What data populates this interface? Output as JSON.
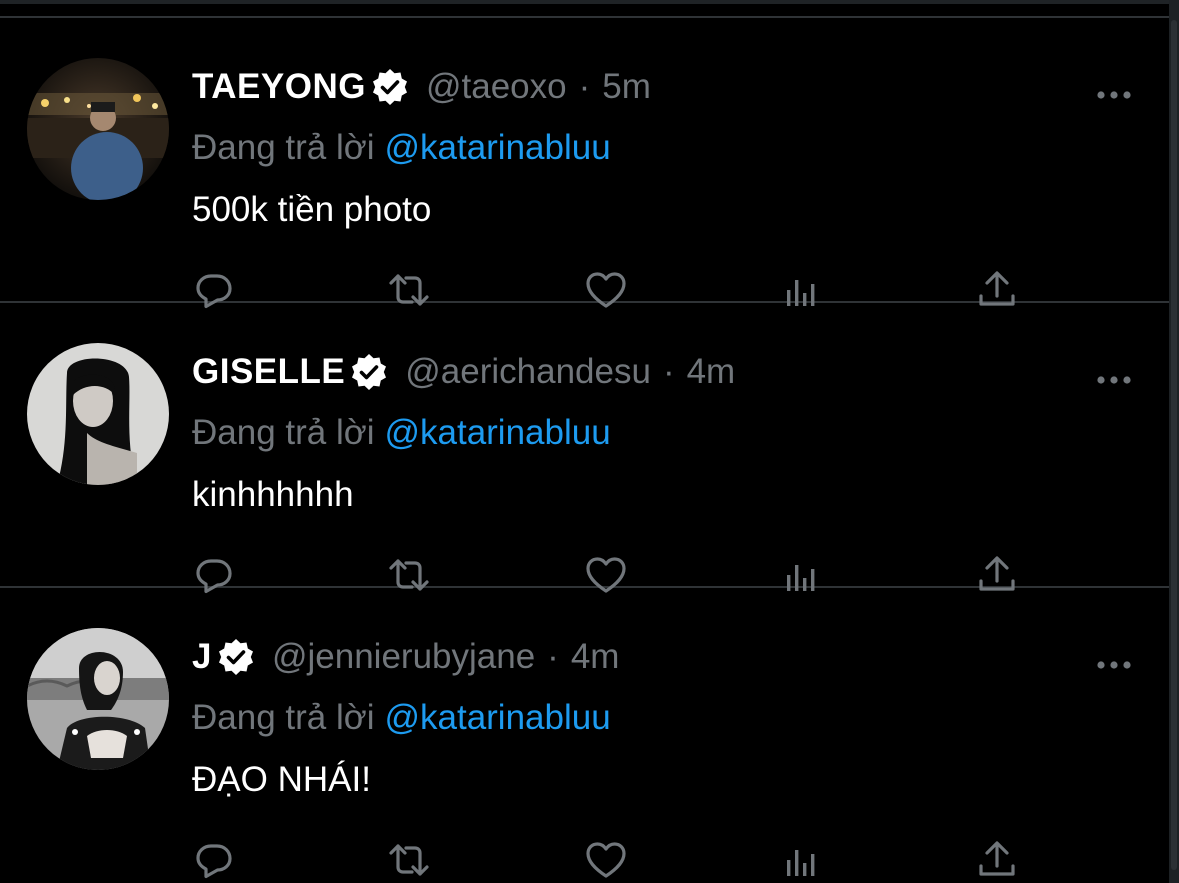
{
  "colors": {
    "background": "#000000",
    "divider": "#2f3336",
    "text_primary": "#ffffff",
    "text_secondary": "#71767b",
    "link": "#1d9bf0",
    "icon": "#71767b"
  },
  "tweets": [
    {
      "display_name": "TAEYONG",
      "verified": true,
      "handle": "@taeoxo",
      "separator": "·",
      "time": "5m",
      "reply_prefix": "Đang trả lời",
      "reply_to": "@katarinabluu",
      "text": "500k tiền photo",
      "avatar_icon": "avatar-photo"
    },
    {
      "display_name": "GISELLE",
      "verified": true,
      "handle": "@aerichandesu",
      "separator": "·",
      "time": "4m",
      "reply_prefix": "Đang trả lời",
      "reply_to": "@katarinabluu",
      "text": "kinhhhhhh",
      "avatar_icon": "avatar-photo"
    },
    {
      "display_name": "J",
      "verified": true,
      "handle": "@jennierubyjane",
      "separator": "·",
      "time": "4m",
      "reply_prefix": "Đang trả lời",
      "reply_to": "@katarinabluu",
      "text": "ĐẠO NHÁI!",
      "avatar_icon": "avatar-photo"
    }
  ],
  "action_icons": [
    "reply-icon",
    "retweet-icon",
    "like-icon",
    "analytics-icon",
    "share-icon"
  ],
  "more_icon": "more-icon",
  "verified_icon": "verified-badge-icon"
}
